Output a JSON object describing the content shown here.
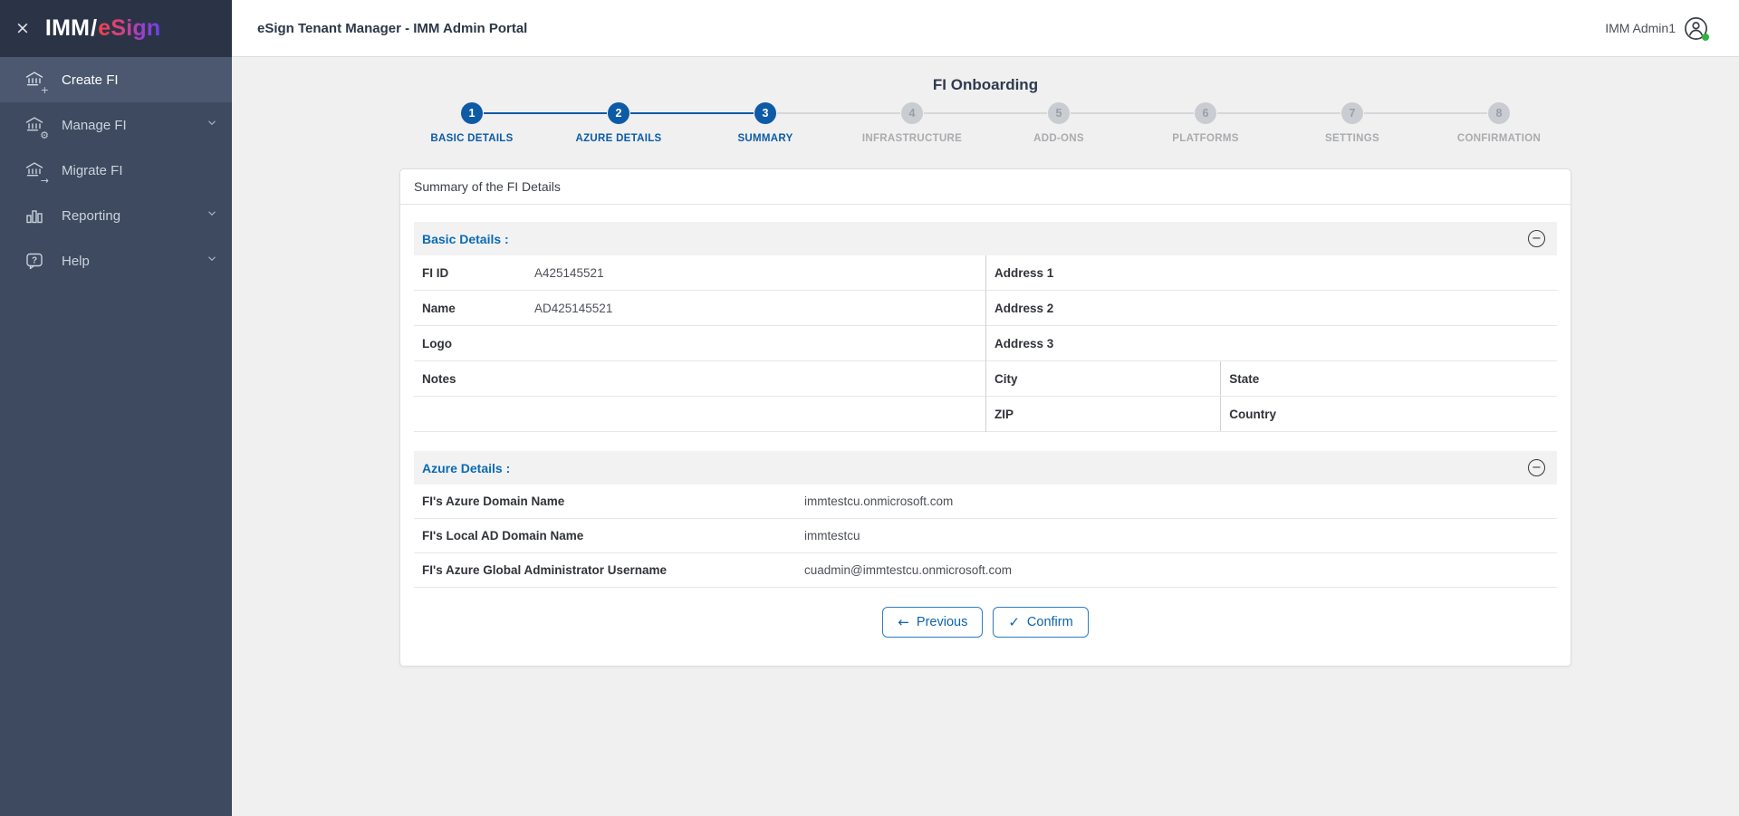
{
  "colors": {
    "accent_blue": "#0d5ba7",
    "section_title_blue": "#0a6bb5",
    "sidebar_bg": "#3d4a5f",
    "sidebar_active_bg": "#4b5870",
    "logo_bar_bg": "#2b3447",
    "online_green": "#2fb344",
    "pending_gray": "#c9ccd1",
    "page_bg": "#f0f0f0"
  },
  "icons": {
    "close": "×",
    "collapse": "−",
    "previous_arrow": "←",
    "confirm_check": "✓",
    "create_badge": "+",
    "manage_badge": "⚙",
    "migrate_badge": "→"
  },
  "sidebar": {
    "logo": {
      "imm": "IMM",
      "slash": "/",
      "esign": "eSign"
    },
    "items": [
      {
        "label": "Create FI",
        "icon": "bank-plus-icon",
        "active": true,
        "chevron": false
      },
      {
        "label": "Manage FI",
        "icon": "bank-gear-icon",
        "active": false,
        "chevron": true
      },
      {
        "label": "Migrate FI",
        "icon": "bank-arrow-icon",
        "active": false,
        "chevron": false
      },
      {
        "label": "Reporting",
        "icon": "bar-chart-icon",
        "active": false,
        "chevron": true
      },
      {
        "label": "Help",
        "icon": "help-bubble-icon",
        "active": false,
        "chevron": true
      }
    ]
  },
  "header": {
    "title": "eSign Tenant Manager - IMM Admin Portal",
    "user": "IMM Admin1"
  },
  "wizard": {
    "title": "FI Onboarding",
    "steps": [
      {
        "num": "1",
        "label": "BASIC DETAILS",
        "state": "done"
      },
      {
        "num": "2",
        "label": "AZURE DETAILS",
        "state": "done"
      },
      {
        "num": "3",
        "label": "SUMMARY",
        "state": "active"
      },
      {
        "num": "4",
        "label": "INFRASTRUCTURE",
        "state": "pending"
      },
      {
        "num": "5",
        "label": "ADD-ONS",
        "state": "pending"
      },
      {
        "num": "6",
        "label": "PLATFORMS",
        "state": "pending"
      },
      {
        "num": "7",
        "label": "SETTINGS",
        "state": "pending"
      },
      {
        "num": "8",
        "label": "CONFIRMATION",
        "state": "pending"
      }
    ]
  },
  "card": {
    "title": "Summary of the FI Details",
    "basic": {
      "heading": "Basic Details :",
      "left_rows": [
        {
          "label": "FI ID",
          "value": "A425145521"
        },
        {
          "label": "Name",
          "value": "AD425145521"
        },
        {
          "label": "Logo",
          "value": ""
        },
        {
          "label": "Notes",
          "value": ""
        },
        {
          "label": "",
          "value": ""
        }
      ],
      "right_rows": [
        {
          "cells": [
            "Address 1"
          ]
        },
        {
          "cells": [
            "Address 2"
          ]
        },
        {
          "cells": [
            "Address 3"
          ]
        },
        {
          "cells": [
            "City",
            "State"
          ]
        },
        {
          "cells": [
            "ZIP",
            "Country"
          ]
        }
      ]
    },
    "azure": {
      "heading": "Azure Details :",
      "rows": [
        {
          "label": "FI's Azure Domain Name",
          "value": "immtestcu.onmicrosoft.com"
        },
        {
          "label": "FI's Local AD Domain Name",
          "value": "immtestcu"
        },
        {
          "label": "FI's Azure Global Administrator Username",
          "value": "cuadmin@immtestcu.onmicrosoft.com"
        }
      ]
    },
    "actions": {
      "previous": "Previous",
      "confirm": "Confirm"
    }
  }
}
